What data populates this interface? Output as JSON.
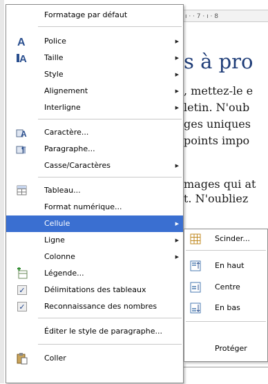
{
  "document": {
    "ruler": "ı · · 7 · ı · 8",
    "heading": "s à pro",
    "lines": [
      ", mettez-le e",
      "letin. N'oub",
      "ges uniques",
      " points impo",
      "mages qui at",
      "t. N'oubliez"
    ]
  },
  "menu": {
    "items": [
      {
        "label": "Formatage par défaut",
        "icon": "none",
        "arrow": false
      },
      {
        "label": "Police",
        "icon": "font-icon",
        "arrow": true
      },
      {
        "label": "Taille",
        "icon": "font-size-icon",
        "arrow": true
      },
      {
        "label": "Style",
        "icon": "none",
        "arrow": true
      },
      {
        "label": "Alignement",
        "icon": "none",
        "arrow": true
      },
      {
        "label": "Interligne",
        "icon": "none",
        "arrow": true
      },
      {
        "label": "Caractère...",
        "icon": "character-icon",
        "arrow": false
      },
      {
        "label": "Paragraphe...",
        "icon": "paragraph-icon",
        "arrow": false
      },
      {
        "label": "Casse/Caractères",
        "icon": "none",
        "arrow": true
      },
      {
        "label": "Tableau...",
        "icon": "table-icon",
        "arrow": false
      },
      {
        "label": "Format numérique...",
        "icon": "none",
        "arrow": false
      },
      {
        "label": "Cellule",
        "icon": "none",
        "arrow": true,
        "highlighted": true
      },
      {
        "label": "Ligne",
        "icon": "none",
        "arrow": true
      },
      {
        "label": "Colonne",
        "icon": "none",
        "arrow": true
      },
      {
        "label": "Légende...",
        "icon": "caption-icon",
        "arrow": false
      },
      {
        "label": "Délimitations des tableaux",
        "icon": "checkmark-icon",
        "arrow": false
      },
      {
        "label": "Reconnaissance des nombres",
        "icon": "checkmark-icon",
        "arrow": false
      },
      {
        "label": "Éditer le style de paragraphe...",
        "icon": "none",
        "arrow": false
      },
      {
        "label": "Coller",
        "icon": "paste-icon",
        "arrow": false
      }
    ]
  },
  "submenu": {
    "items": [
      {
        "label": "Scinder...",
        "icon": "split-cells-icon"
      },
      {
        "label": "En haut",
        "icon": "align-top-icon"
      },
      {
        "label": "Centre",
        "icon": "align-center-icon"
      },
      {
        "label": "En bas",
        "icon": "align-bottom-icon"
      },
      {
        "label": "Protéger",
        "icon": "none"
      }
    ]
  },
  "colors": {
    "highlight": "#3a6fd1",
    "heading": "#1f3d78"
  }
}
